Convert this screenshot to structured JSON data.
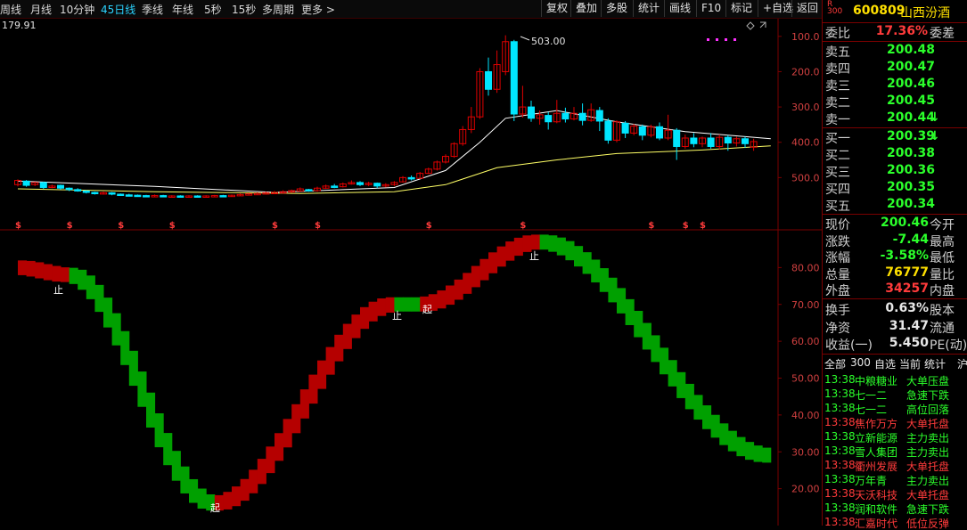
{
  "toolbar": {
    "periods": [
      "周线",
      "月线",
      "10分钟",
      "45日线",
      "季线",
      "年线",
      "5秒",
      "15秒",
      "多周期",
      "更多 >"
    ],
    "active_period": "45日线",
    "buttons": [
      "复权",
      "叠加",
      "多股",
      "统计",
      "画线",
      "F10",
      "标记",
      "+自选",
      "返回"
    ]
  },
  "chart": {
    "left_value": "179.91",
    "peak_label": "503.00",
    "price_ticks": [
      "500.0",
      "400.0",
      "300.0",
      "200.0",
      "100.0"
    ],
    "ind_ticks": [
      "80.00",
      "70.00",
      "60.00",
      "50.00",
      "40.00",
      "30.00",
      "20.00"
    ],
    "start_label": "起",
    "stop_label": "止",
    "marker_symbol": "$",
    "colors": {
      "up": "#e00000",
      "down": "#00e5ff",
      "ma_short": "#ffffff",
      "ma_long": "#ffff66",
      "band_up": "#b50000",
      "band_down": "#00a000",
      "frame": "#7a0000"
    }
  },
  "chart_data": {
    "type": "candlestick",
    "ylim": [
      0,
      550
    ],
    "price_ticks": [
      100,
      200,
      300,
      400,
      500
    ],
    "indicator_ylim": [
      10,
      90
    ],
    "indicator_ticks": [
      20,
      30,
      40,
      50,
      60,
      70,
      80
    ],
    "candles": [
      {
        "o": 80,
        "c": 92,
        "h": 95,
        "l": 75
      },
      {
        "o": 90,
        "c": 78,
        "h": 93,
        "l": 74
      },
      {
        "o": 80,
        "c": 86,
        "h": 88,
        "l": 76
      },
      {
        "o": 86,
        "c": 72,
        "h": 88,
        "l": 68
      },
      {
        "o": 72,
        "c": 76,
        "h": 80,
        "l": 70
      },
      {
        "o": 78,
        "c": 70,
        "h": 80,
        "l": 66
      },
      {
        "o": 70,
        "c": 66,
        "h": 72,
        "l": 62
      },
      {
        "o": 66,
        "c": 62,
        "h": 70,
        "l": 60
      },
      {
        "o": 62,
        "c": 58,
        "h": 64,
        "l": 55
      },
      {
        "o": 58,
        "c": 56,
        "h": 60,
        "l": 52
      },
      {
        "o": 55,
        "c": 57,
        "h": 60,
        "l": 52
      },
      {
        "o": 57,
        "c": 53,
        "h": 59,
        "l": 50
      },
      {
        "o": 53,
        "c": 51,
        "h": 55,
        "l": 48
      },
      {
        "o": 51,
        "c": 50,
        "h": 54,
        "l": 47
      },
      {
        "o": 50,
        "c": 49,
        "h": 52,
        "l": 46
      },
      {
        "o": 49,
        "c": 48,
        "h": 51,
        "l": 45
      },
      {
        "o": 48,
        "c": 49,
        "h": 52,
        "l": 46
      },
      {
        "o": 49,
        "c": 47,
        "h": 51,
        "l": 45
      },
      {
        "o": 47,
        "c": 48,
        "h": 50,
        "l": 45
      },
      {
        "o": 48,
        "c": 47,
        "h": 50,
        "l": 45
      },
      {
        "o": 47,
        "c": 48,
        "h": 50,
        "l": 45
      },
      {
        "o": 48,
        "c": 47,
        "h": 50,
        "l": 45
      },
      {
        "o": 47,
        "c": 48,
        "h": 50,
        "l": 45
      },
      {
        "o": 48,
        "c": 49,
        "h": 51,
        "l": 46
      },
      {
        "o": 49,
        "c": 48,
        "h": 51,
        "l": 46
      },
      {
        "o": 48,
        "c": 50,
        "h": 52,
        "l": 46
      },
      {
        "o": 50,
        "c": 52,
        "h": 55,
        "l": 48
      },
      {
        "o": 52,
        "c": 54,
        "h": 56,
        "l": 50
      },
      {
        "o": 54,
        "c": 55,
        "h": 58,
        "l": 52
      },
      {
        "o": 55,
        "c": 57,
        "h": 60,
        "l": 52
      },
      {
        "o": 57,
        "c": 58,
        "h": 62,
        "l": 54
      },
      {
        "o": 58,
        "c": 60,
        "h": 64,
        "l": 55
      },
      {
        "o": 60,
        "c": 63,
        "h": 66,
        "l": 57
      },
      {
        "o": 62,
        "c": 68,
        "h": 72,
        "l": 60
      },
      {
        "o": 66,
        "c": 62,
        "h": 68,
        "l": 60
      },
      {
        "o": 63,
        "c": 70,
        "h": 74,
        "l": 60
      },
      {
        "o": 70,
        "c": 76,
        "h": 80,
        "l": 68
      },
      {
        "o": 76,
        "c": 72,
        "h": 82,
        "l": 70
      },
      {
        "o": 74,
        "c": 82,
        "h": 86,
        "l": 72
      },
      {
        "o": 82,
        "c": 86,
        "h": 92,
        "l": 80
      },
      {
        "o": 86,
        "c": 80,
        "h": 90,
        "l": 76
      },
      {
        "o": 80,
        "c": 84,
        "h": 88,
        "l": 76
      },
      {
        "o": 84,
        "c": 76,
        "h": 86,
        "l": 70
      },
      {
        "o": 76,
        "c": 80,
        "h": 84,
        "l": 72
      },
      {
        "o": 80,
        "c": 86,
        "h": 90,
        "l": 76
      },
      {
        "o": 88,
        "c": 100,
        "h": 104,
        "l": 86
      },
      {
        "o": 100,
        "c": 96,
        "h": 106,
        "l": 92
      },
      {
        "o": 98,
        "c": 112,
        "h": 116,
        "l": 96
      },
      {
        "o": 112,
        "c": 124,
        "h": 128,
        "l": 110
      },
      {
        "o": 124,
        "c": 144,
        "h": 148,
        "l": 120
      },
      {
        "o": 144,
        "c": 160,
        "h": 166,
        "l": 140
      },
      {
        "o": 160,
        "c": 196,
        "h": 200,
        "l": 156
      },
      {
        "o": 196,
        "c": 236,
        "h": 246,
        "l": 190
      },
      {
        "o": 236,
        "c": 272,
        "h": 300,
        "l": 226
      },
      {
        "o": 272,
        "c": 400,
        "h": 410,
        "l": 266
      },
      {
        "o": 400,
        "c": 350,
        "h": 440,
        "l": 332
      },
      {
        "o": 350,
        "c": 420,
        "h": 460,
        "l": 340
      },
      {
        "o": 400,
        "c": 485,
        "h": 503,
        "l": 390
      },
      {
        "o": 485,
        "c": 280,
        "h": 490,
        "l": 260
      },
      {
        "o": 280,
        "c": 300,
        "h": 360,
        "l": 270
      },
      {
        "o": 300,
        "c": 268,
        "h": 318,
        "l": 258
      },
      {
        "o": 268,
        "c": 278,
        "h": 290,
        "l": 250
      },
      {
        "o": 276,
        "c": 258,
        "h": 286,
        "l": 236
      },
      {
        "o": 258,
        "c": 282,
        "h": 320,
        "l": 254
      },
      {
        "o": 282,
        "c": 266,
        "h": 298,
        "l": 256
      },
      {
        "o": 266,
        "c": 282,
        "h": 300,
        "l": 262
      },
      {
        "o": 282,
        "c": 262,
        "h": 310,
        "l": 248
      },
      {
        "o": 262,
        "c": 292,
        "h": 310,
        "l": 258
      },
      {
        "o": 290,
        "c": 260,
        "h": 300,
        "l": 232
      },
      {
        "o": 260,
        "c": 206,
        "h": 268,
        "l": 196
      },
      {
        "o": 206,
        "c": 258,
        "h": 262,
        "l": 200
      },
      {
        "o": 254,
        "c": 226,
        "h": 260,
        "l": 212
      },
      {
        "o": 226,
        "c": 246,
        "h": 252,
        "l": 220
      },
      {
        "o": 244,
        "c": 220,
        "h": 250,
        "l": 206
      },
      {
        "o": 220,
        "c": 244,
        "h": 250,
        "l": 214
      },
      {
        "o": 244,
        "c": 212,
        "h": 256,
        "l": 206
      },
      {
        "o": 212,
        "c": 234,
        "h": 278,
        "l": 206
      },
      {
        "o": 234,
        "c": 188,
        "h": 240,
        "l": 150
      },
      {
        "o": 188,
        "c": 212,
        "h": 222,
        "l": 182
      },
      {
        "o": 212,
        "c": 196,
        "h": 226,
        "l": 186
      },
      {
        "o": 196,
        "c": 212,
        "h": 216,
        "l": 186
      },
      {
        "o": 212,
        "c": 188,
        "h": 226,
        "l": 182
      },
      {
        "o": 188,
        "c": 214,
        "h": 222,
        "l": 180
      },
      {
        "o": 214,
        "c": 198,
        "h": 220,
        "l": 176
      },
      {
        "o": 198,
        "c": 210,
        "h": 216,
        "l": 188
      },
      {
        "o": 210,
        "c": 196,
        "h": 216,
        "l": 184
      },
      {
        "o": 186,
        "c": 202,
        "h": 210,
        "l": 176
      }
    ],
    "ma_short_points": [
      [
        0,
        90
      ],
      [
        16,
        75
      ],
      [
        30,
        58
      ],
      [
        44,
        72
      ],
      [
        50,
        120
      ],
      [
        54,
        200
      ],
      [
        57,
        268
      ],
      [
        63,
        290
      ],
      [
        70,
        258
      ],
      [
        78,
        230
      ],
      [
        88,
        210
      ]
    ],
    "ma_long_points": [
      [
        0,
        68
      ],
      [
        16,
        60
      ],
      [
        33,
        55
      ],
      [
        44,
        60
      ],
      [
        50,
        80
      ],
      [
        56,
        128
      ],
      [
        63,
        150
      ],
      [
        70,
        168
      ],
      [
        80,
        178
      ],
      [
        88,
        190
      ]
    ],
    "indicator": [
      {
        "band": "up",
        "from": [
          0,
          80
        ],
        "to": [
          6,
          78
        ]
      },
      {
        "band": "down",
        "from": [
          6,
          78
        ],
        "to": [
          23,
          16
        ]
      },
      {
        "band": "up",
        "from": [
          23,
          16
        ],
        "to": [
          44,
          70
        ]
      },
      {
        "band": "down",
        "from": [
          44,
          70
        ],
        "to": [
          47,
          70
        ]
      },
      {
        "band": "up",
        "from": [
          47,
          70
        ],
        "to": [
          61,
          87
        ]
      },
      {
        "band": "down",
        "from": [
          61,
          87
        ],
        "to": [
          88,
          29
        ]
      }
    ]
  },
  "quote": {
    "code": "600809",
    "name": "山西汾酒",
    "badge_top": "R",
    "badge_bottom": "300",
    "weibi_label": "委比",
    "weibi_value": "17.36%",
    "weicha_label": "委差",
    "sells": [
      {
        "label": "卖五",
        "price": "200.48"
      },
      {
        "label": "卖四",
        "price": "200.47"
      },
      {
        "label": "卖三",
        "price": "200.46"
      },
      {
        "label": "卖二",
        "price": "200.45"
      },
      {
        "label": "卖一",
        "price": "200.44"
      }
    ],
    "buys": [
      {
        "label": "买一",
        "price": "200.39"
      },
      {
        "label": "买二",
        "price": "200.38"
      },
      {
        "label": "买三",
        "price": "200.36"
      },
      {
        "label": "买四",
        "price": "200.35"
      },
      {
        "label": "买五",
        "price": "200.34"
      }
    ],
    "stats": [
      {
        "label": "现价",
        "value": "200.46",
        "label2": "今开",
        "cls": "dn"
      },
      {
        "label": "涨跌",
        "value": "-7.44",
        "label2": "最高",
        "cls": "dn"
      },
      {
        "label": "涨幅",
        "value": "-3.58%",
        "label2": "最低",
        "cls": "dn"
      },
      {
        "label": "总量",
        "value": "76777",
        "label2": "量比",
        "cls": "yel"
      },
      {
        "label": "外盘",
        "value": "34257",
        "label2": "内盘",
        "cls": "up"
      }
    ],
    "stats2": [
      {
        "label": "换手",
        "value": "0.63%",
        "label2": "股本"
      },
      {
        "label": "净资",
        "value": "31.47",
        "label2": "流通"
      },
      {
        "label": "收益(一)",
        "value": "5.450",
        "label2": "PE(动)"
      }
    ]
  },
  "news": {
    "tabs": [
      "全部",
      "300",
      "自选",
      "当前",
      "统计",
      "沪"
    ],
    "items": [
      {
        "time": "13:38",
        "name": "中粮糖业",
        "event": "大单压盘",
        "color": "#2bff2b"
      },
      {
        "time": "13:38",
        "name": "七一二",
        "event": "急速下跌",
        "color": "#2bff2b"
      },
      {
        "time": "13:38",
        "name": "七一二",
        "event": "高位回落",
        "color": "#2bff2b"
      },
      {
        "time": "13:38",
        "name": "焦作万方",
        "event": "大单托盘",
        "color": "#ff3b3b"
      },
      {
        "time": "13:38",
        "name": "立新能源",
        "event": "主力卖出",
        "color": "#2bff2b"
      },
      {
        "time": "13:38",
        "name": "雪人集团",
        "event": "主力卖出",
        "color": "#2bff2b"
      },
      {
        "time": "13:38",
        "name": "衢州发展",
        "event": "大单托盘",
        "color": "#ff3b3b"
      },
      {
        "time": "13:38",
        "name": "万年青",
        "event": "主力卖出",
        "color": "#2bff2b"
      },
      {
        "time": "13:38",
        "name": "天沃科技",
        "event": "大单托盘",
        "color": "#ff3b3b"
      },
      {
        "time": "13:38",
        "name": "润和软件",
        "event": "急速下跌",
        "color": "#2bff2b"
      },
      {
        "time": "13:38",
        "name": "汇嘉时代",
        "event": "低位反弹",
        "color": "#ff3b3b"
      }
    ]
  }
}
